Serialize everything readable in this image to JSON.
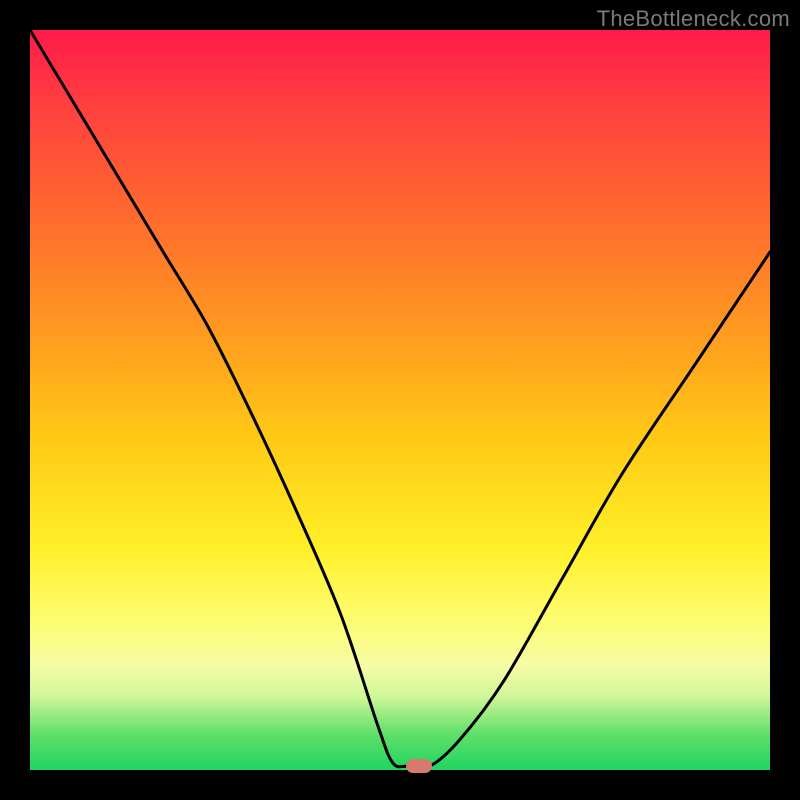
{
  "watermark": "TheBottleneck.com",
  "colors": {
    "frame": "#000000",
    "gradient_stops": [
      "#ff1a4a",
      "#ff3f3f",
      "#ff6a2f",
      "#ff9821",
      "#ffc915",
      "#fff028",
      "#fdfd72",
      "#f6fca5",
      "#d0f79a",
      "#63e06a",
      "#1fd560"
    ],
    "curve_stroke": "#000000",
    "marker_fill": "#d9786f"
  },
  "chart_data": {
    "type": "line",
    "title": "",
    "xlabel": "",
    "ylabel": "",
    "xlim": [
      0,
      100
    ],
    "ylim": [
      0,
      100
    ],
    "grid": false,
    "legend": false,
    "series": [
      {
        "name": "bottleneck-curve",
        "x": [
          0,
          6,
          12,
          18,
          24,
          30,
          36,
          42,
          47,
          49,
          51,
          54,
          58,
          64,
          72,
          80,
          90,
          100
        ],
        "y": [
          100,
          90,
          80,
          70,
          60,
          48,
          35,
          21,
          6,
          1,
          0.5,
          0.5,
          4,
          12,
          26,
          40,
          55,
          70
        ]
      }
    ],
    "annotations": [
      {
        "name": "min-marker",
        "x": 52.5,
        "y": 0.5
      }
    ]
  }
}
